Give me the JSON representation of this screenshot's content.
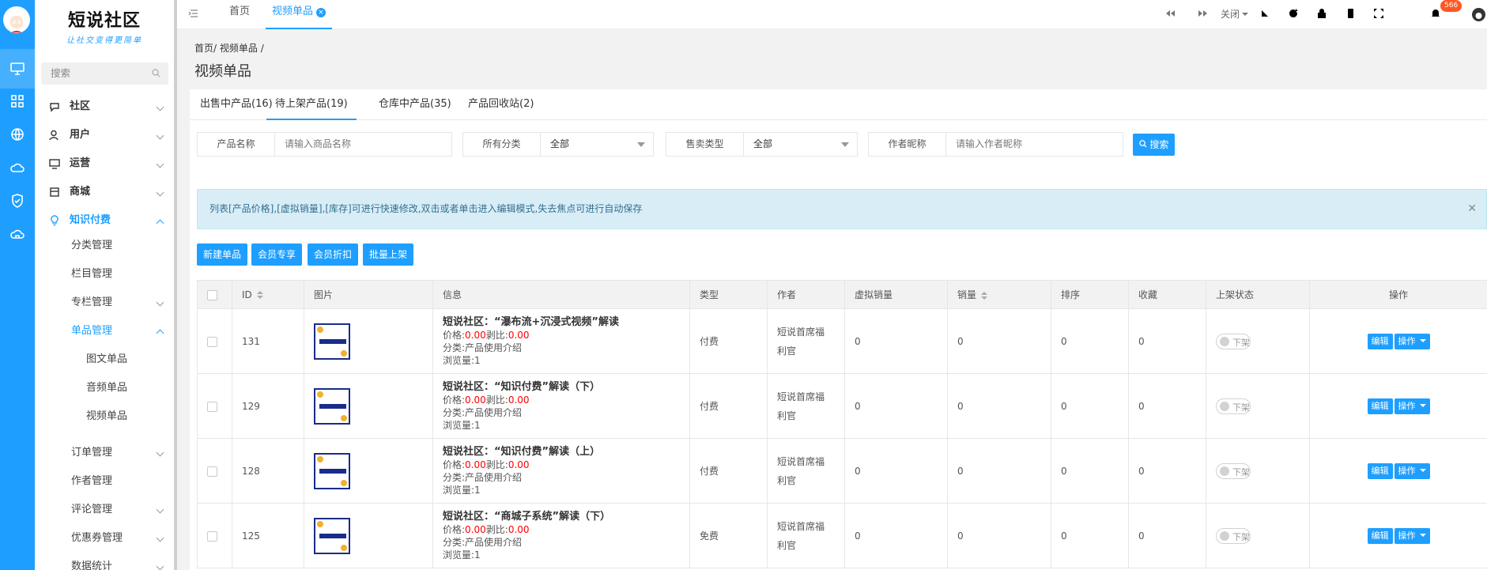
{
  "sidebar": {
    "logo_title": "短说社区",
    "logo_subtitle": "让社交变得更简单",
    "search_placeholder": "搜索",
    "menu": [
      {
        "label": "社区",
        "icon": "chat-icon"
      },
      {
        "label": "用户",
        "icon": "user-icon"
      },
      {
        "label": "运营",
        "icon": "monitor-icon"
      },
      {
        "label": "商城",
        "icon": "store-icon"
      },
      {
        "label": "知识付费",
        "icon": "bulb-icon"
      }
    ],
    "sub_menu": [
      "分类管理",
      "栏目管理",
      "专栏管理",
      "单品管理"
    ],
    "third_menu": [
      "图文单品",
      "音频单品",
      "视频单品"
    ],
    "more_menu": [
      "订单管理",
      "作者管理",
      "评论管理",
      "优惠券管理",
      "数据统计"
    ]
  },
  "topbar": {
    "tabs": [
      "首页",
      "视频单品"
    ],
    "close_label": "关闭",
    "notification_count": "566"
  },
  "breadcrumb": {
    "home": "首页",
    "sep": "/",
    "current": "视频单品"
  },
  "page_title": "视频单品",
  "product_tabs": [
    "出售中产品(16)",
    "待上架产品(19)",
    "仓库中产品(35)",
    "产品回收站(2)"
  ],
  "filters": {
    "name_label": "产品名称",
    "name_placeholder": "请输入商品名称",
    "category_label": "所有分类",
    "category_value": "全部",
    "sale_type_label": "售卖类型",
    "sale_type_value": "全部",
    "author_label": "作者昵称",
    "author_placeholder": "请输入作者昵称",
    "search_button": "搜索"
  },
  "tip": "列表[产品价格],[虚拟销量],[库存]可进行快速修改,双击或者单击进入编辑模式,失去焦点可进行自动保存",
  "actions": [
    "新建单品",
    "会员专享",
    "会员折扣",
    "批量上架"
  ],
  "table": {
    "columns": [
      "ID",
      "图片",
      "信息",
      "类型",
      "作者",
      "虚拟销量",
      "销量",
      "排序",
      "收藏",
      "上架状态",
      "操作"
    ],
    "rows": [
      {
        "id": "131",
        "title": "短说社区：“瀑布流+沉浸式视频”解读",
        "price_label": "价格:",
        "price": "0.00",
        "ratio_label": "剥比:",
        "ratio": "0.00",
        "category": "分类:产品使用介绍",
        "views": "浏览量:1",
        "type": "付费",
        "author": "短说首席福利官",
        "virtual_sales": "0",
        "sales": "0",
        "sort": "0",
        "favorites": "0",
        "status": "下架"
      },
      {
        "id": "129",
        "title": "短说社区：“知识付费”解读（下）",
        "price_label": "价格:",
        "price": "0.00",
        "ratio_label": "剥比:",
        "ratio": "0.00",
        "category": "分类:产品使用介绍",
        "views": "浏览量:1",
        "type": "付费",
        "author": "短说首席福利官",
        "virtual_sales": "0",
        "sales": "0",
        "sort": "0",
        "favorites": "0",
        "status": "下架"
      },
      {
        "id": "128",
        "title": "短说社区：“知识付费”解读（上）",
        "price_label": "价格:",
        "price": "0.00",
        "ratio_label": "剥比:",
        "ratio": "0.00",
        "category": "分类:产品使用介绍",
        "views": "浏览量:1",
        "type": "付费",
        "author": "短说首席福利官",
        "virtual_sales": "0",
        "sales": "0",
        "sort": "0",
        "favorites": "0",
        "status": "下架"
      },
      {
        "id": "125",
        "title": "短说社区：“商城子系统”解读（下）",
        "price_label": "价格:",
        "price": "0.00",
        "ratio_label": "剥比:",
        "ratio": "0.00",
        "category": "分类:产品使用介绍",
        "views": "浏览量:1",
        "type": "免费",
        "author": "短说首席福利官",
        "virtual_sales": "0",
        "sales": "0",
        "sort": "0",
        "favorites": "0",
        "status": "下架"
      }
    ],
    "edit_label": "编辑",
    "op_label": "操作"
  },
  "colors": {
    "accent": "#1E9FFF",
    "price": "#FF0000",
    "badge": "#FF5722"
  }
}
